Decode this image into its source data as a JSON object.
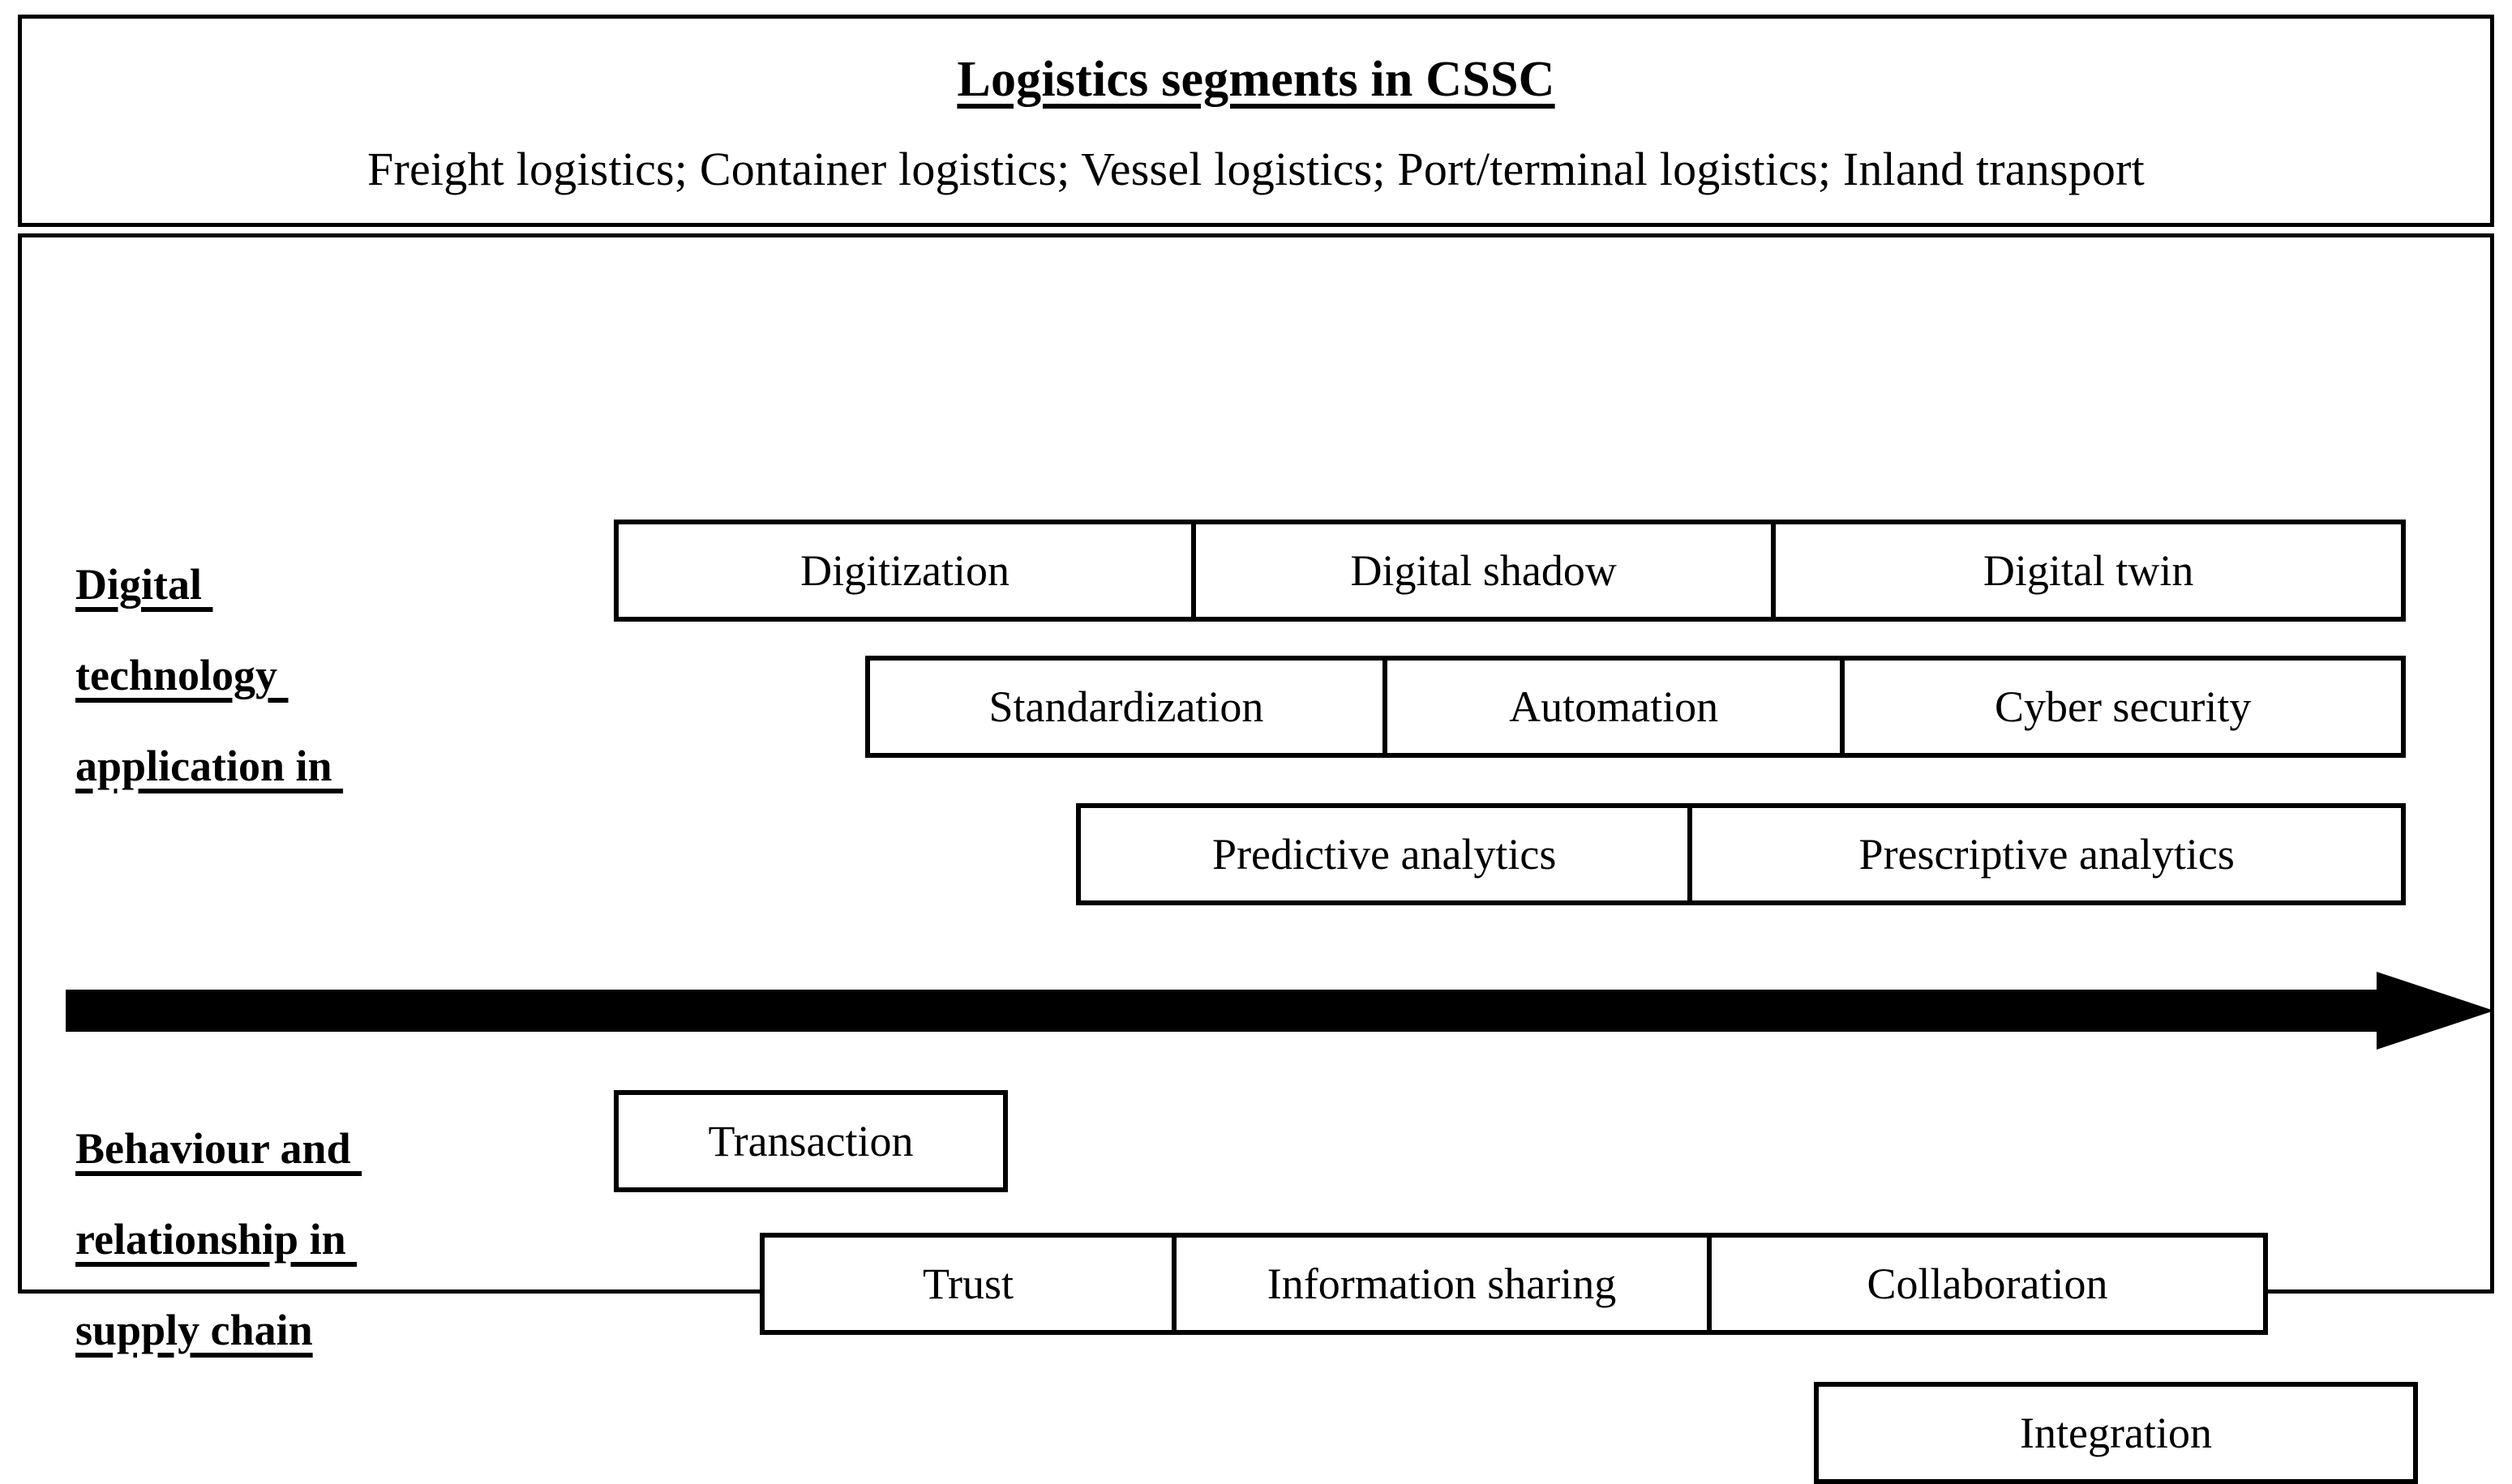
{
  "header": {
    "title": "Logistics segments in CSSC",
    "subtitle": "Freight logistics; Container logistics; Vessel logistics; Port/terminal logistics; Inland transport"
  },
  "sections": [
    {
      "id": "digital-technology",
      "label_lines": [
        "Digital ",
        "technology ",
        "application in "
      ],
      "rows": [
        {
          "id": "row-tech-1",
          "cells": [
            "Digitization",
            "Digital shadow",
            "Digital twin"
          ]
        },
        {
          "id": "row-tech-2",
          "cells": [
            "Standardization",
            "Automation",
            "Cyber security"
          ]
        },
        {
          "id": "row-tech-3",
          "cells": [
            "Predictive analytics",
            "Prescriptive analytics"
          ]
        }
      ]
    },
    {
      "id": "behaviour-relationship",
      "label_lines": [
        "Behaviour and ",
        "relationship in ",
        "supply chain"
      ],
      "rows": [
        {
          "id": "row-beh-1",
          "cells": [
            "Transaction"
          ]
        },
        {
          "id": "row-beh-2",
          "cells": [
            "Trust",
            "Information sharing",
            "Collaboration"
          ]
        },
        {
          "id": "row-beh-3",
          "cells": [
            "Integration"
          ]
        }
      ]
    }
  ],
  "arrow": {
    "name": "maturity-progression-arrow",
    "direction": "right",
    "color": "#000000"
  },
  "colors": {
    "line": "#000000",
    "background": "#ffffff",
    "text": "#000000"
  },
  "cells": {
    "tech_1_0": "Digitization",
    "tech_1_1": "Digital shadow",
    "tech_1_2": "Digital twin",
    "tech_2_0": "Standardization",
    "tech_2_1": "Automation",
    "tech_2_2": "Cyber security",
    "tech_3_0": "Predictive analytics",
    "tech_3_1": "Prescriptive analytics",
    "beh_1_0": "Transaction",
    "beh_2_0": "Trust",
    "beh_2_1": "Information sharing",
    "beh_2_2": "Collaboration",
    "beh_3_0": "Integration"
  },
  "labels": {
    "digital_l1": "Digital ",
    "digital_l2": "technology ",
    "digital_l3": "application in ",
    "behaviour_l1": "Behaviour and ",
    "behaviour_l2": "relationship in ",
    "behaviour_l3": "supply chain"
  }
}
